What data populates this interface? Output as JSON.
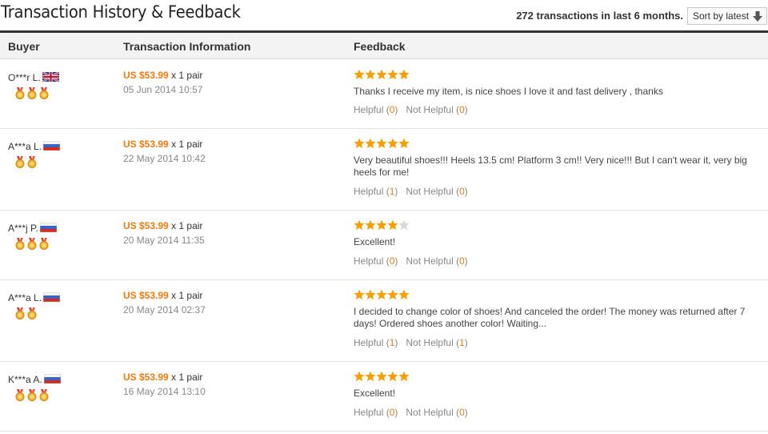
{
  "header": {
    "title": "Transaction History & Feedback",
    "summary": "272 transactions in last 6 months.",
    "sort_label": "Sort by latest",
    "sort_icon": "arrow-down-icon"
  },
  "columns": {
    "buyer": "Buyer",
    "transaction": "Transaction Information",
    "feedback": "Feedback"
  },
  "colors": {
    "accent_orange": "#f27a10",
    "star_gold": "#f5a000",
    "star_empty": "#d8d8d8"
  },
  "labels": {
    "helpful": "Helpful",
    "not_helpful": "Not Helpful"
  },
  "rows": [
    {
      "buyer": "O***r L.",
      "country": "uk",
      "medals": 3,
      "price": "US $53.99",
      "quantity": "x 1 pair",
      "date": "05 Jun 2014 10:57",
      "stars": 5,
      "comment": "Thanks I receive my item, is nice shoes I love it and fast delivery , thanks",
      "helpful": "0",
      "not_helpful": "0"
    },
    {
      "buyer": "A***a L.",
      "country": "ru",
      "medals": 2,
      "price": "US $53.99",
      "quantity": "x 1 pair",
      "date": "22 May 2014 10:42",
      "stars": 5,
      "comment": "Very beautiful shoes!!! Heels 13.5 cm! Platform 3 cm!! Very nice!!! But I can't wear it, very big heels for me!",
      "helpful": "1",
      "not_helpful": "0"
    },
    {
      "buyer": "A***j P.",
      "country": "ru",
      "medals": 3,
      "price": "US $53.99",
      "quantity": "x 1 pair",
      "date": "20 May 2014 11:35",
      "stars": 4,
      "comment": " Excellent!",
      "helpful": "0",
      "not_helpful": "0"
    },
    {
      "buyer": "A***a L.",
      "country": "ru",
      "medals": 2,
      "price": "US $53.99",
      "quantity": "x 1 pair",
      "date": "20 May 2014 02:37",
      "stars": 5,
      "comment": "I decided to change color of shoes! And canceled the order! The money was returned after 7 days! Ordered shoes another color! Waiting...",
      "helpful": "1",
      "not_helpful": "1"
    },
    {
      "buyer": "K***a A.",
      "country": "ru",
      "medals": 3,
      "price": "US $53.99",
      "quantity": "x 1 pair",
      "date": "16 May 2014 13:10",
      "stars": 5,
      "comment": "Excellent!",
      "helpful": "0",
      "not_helpful": "0"
    }
  ]
}
